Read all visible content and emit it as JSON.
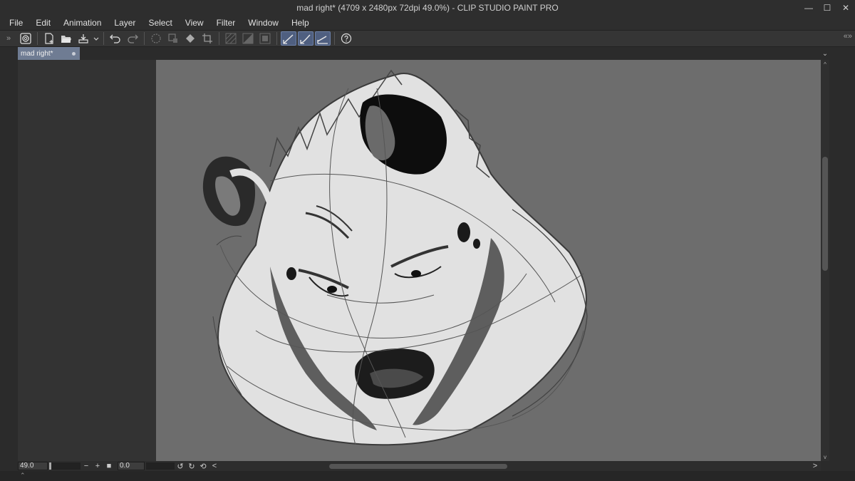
{
  "window": {
    "title": "mad right* (4709 x 2480px 72dpi 49.0%)  - CLIP STUDIO PAINT PRO",
    "minimize_label": "—",
    "maximize_label": "☐",
    "close_label": "✕"
  },
  "menu": {
    "items": [
      "File",
      "Edit",
      "Animation",
      "Layer",
      "Select",
      "View",
      "Filter",
      "Window",
      "Help"
    ]
  },
  "toolbar": {
    "grip_left": "»",
    "grip_right": "«»",
    "icons": [
      "clip-studio-icon",
      "new-canvas-icon",
      "open-folder-icon",
      "save-icon",
      "undo-icon",
      "redo-icon",
      "transform-icon",
      "fill-icon",
      "crop-icon",
      "ruler-snap-icons",
      "help-icon"
    ]
  },
  "tabs": {
    "doc_tab_label": "mad right*",
    "chevron": "⌄"
  },
  "status": {
    "zoom_value": "49.0",
    "zoom_minus": "−",
    "zoom_plus": "+",
    "zoom_fit": "■",
    "rotation_value": "0.0",
    "scroll_left": "<",
    "scroll_right": ">",
    "scroll_up": "^",
    "scroll_down": "v",
    "expander": "⌃"
  },
  "colors": {
    "paper": "#6d6d6d",
    "canvas_bg": "#333333",
    "active_button": "#4f5f80",
    "tab_active": "#6f7c93"
  }
}
